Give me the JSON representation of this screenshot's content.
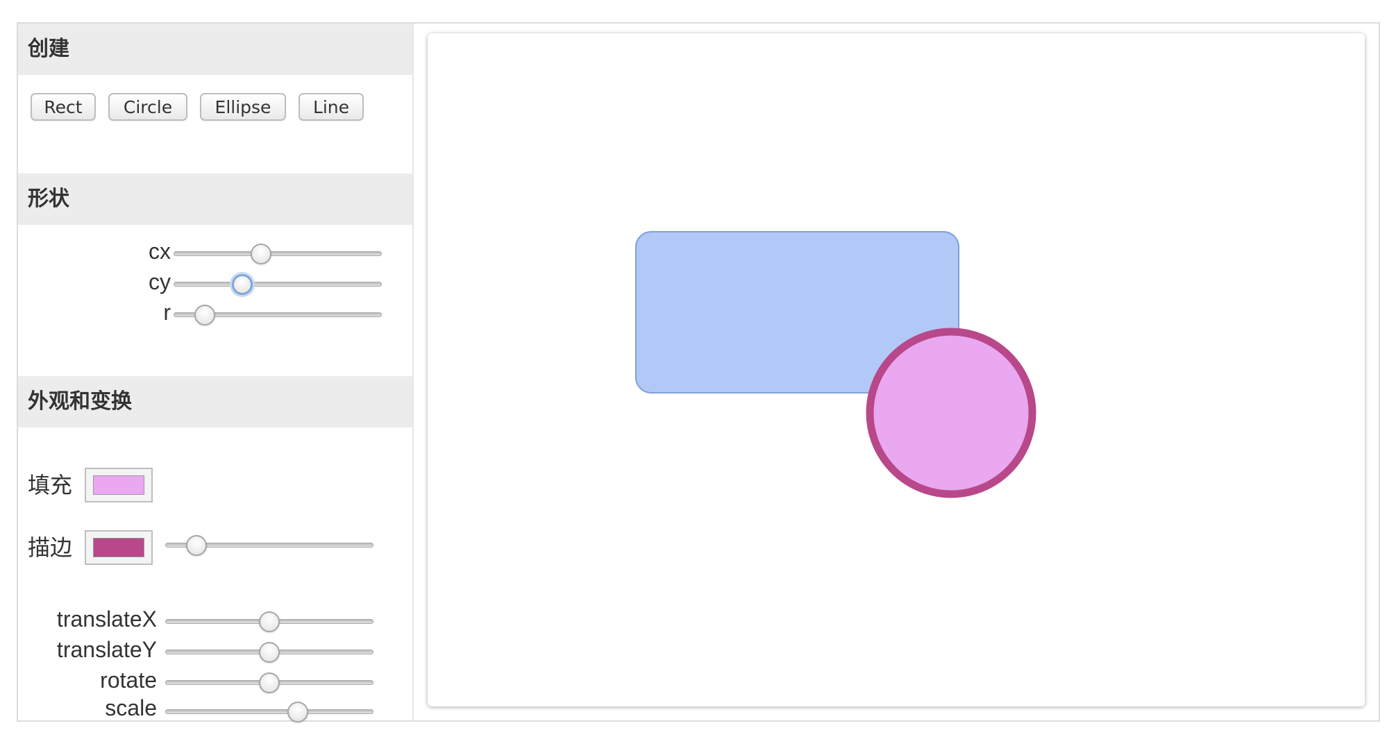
{
  "sections": {
    "create": "创建",
    "shape": "形状",
    "appearance": "外观和变换"
  },
  "create_buttons": [
    "Rect",
    "Circle",
    "Ellipse",
    "Line"
  ],
  "shape_sliders": [
    {
      "label": "cx",
      "value": 0.41
    },
    {
      "label": "cy",
      "value": 0.31
    },
    {
      "label": "r",
      "value": 0.11
    }
  ],
  "fill": {
    "label": "填充",
    "color": "#e9a8f0"
  },
  "stroke": {
    "label": "描边",
    "color": "#b8488a",
    "width_value": 0.11
  },
  "transform_sliders": [
    {
      "label": "translateX",
      "value": 0.5
    },
    {
      "label": "translateY",
      "value": 0.5
    },
    {
      "label": "rotate",
      "value": 0.5
    },
    {
      "label": "scale",
      "value": 0.65
    }
  ],
  "canvas_shapes": {
    "rect": {
      "fill": "#b2c9f8",
      "stroke": "#7ea0d8"
    },
    "circle": {
      "fill": "#e9a8f0",
      "stroke": "#b8488a"
    }
  }
}
